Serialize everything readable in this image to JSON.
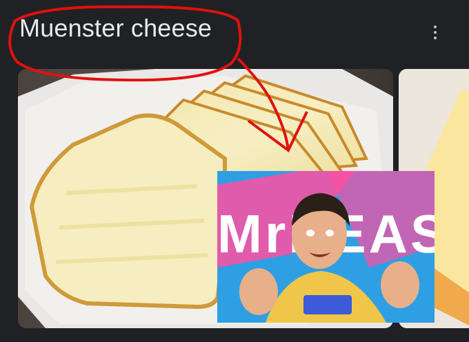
{
  "header": {
    "title": "Muenster cheese",
    "more_icon": "more-vert-icon"
  },
  "results": {
    "main_image": {
      "subject": "sliced-cheese-photo"
    },
    "side_image": {
      "subject": "cheese-block-photo"
    }
  },
  "overlay": {
    "banner_text": "MrBEAST",
    "subject": "person-photo"
  },
  "annotation": {
    "color": "#e0110f",
    "shapes": [
      "circle-around-title",
      "arrow"
    ]
  },
  "colors": {
    "background": "#202124",
    "title_text": "#e8eaed",
    "icon": "#bdc1c6"
  }
}
